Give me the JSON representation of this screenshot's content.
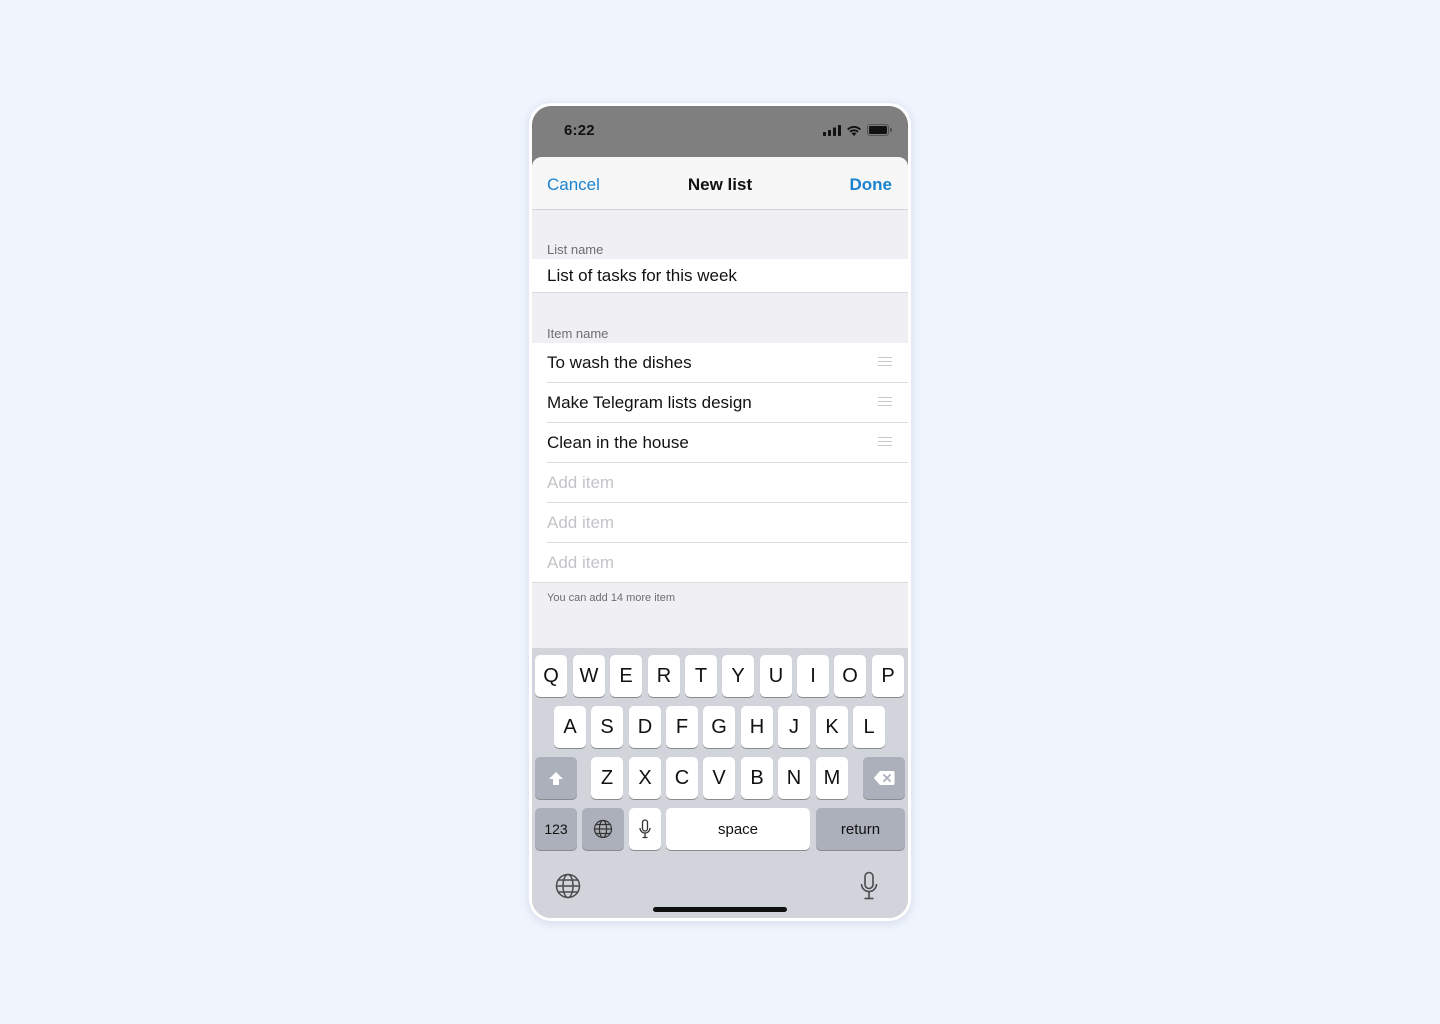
{
  "status_bar": {
    "time": "6:22",
    "icons": [
      "cellular-signal-icon",
      "wifi-icon",
      "battery-icon"
    ]
  },
  "navbar": {
    "cancel_label": "Cancel",
    "title": "New list",
    "done_label": "Done",
    "accent_color": "#1a83cf"
  },
  "list_name": {
    "label": "List name",
    "value": "List of tasks for this week"
  },
  "items": {
    "label": "Item name",
    "entries": [
      {
        "text": "To wash the dishes"
      },
      {
        "text": "Make Telegram lists design"
      },
      {
        "text": "Clean in the house"
      }
    ],
    "empty_placeholders": [
      "Add item",
      "Add item",
      "Add item"
    ],
    "hint": "You can add 14 more item"
  },
  "keyboard": {
    "row1": [
      "Q",
      "W",
      "E",
      "R",
      "T",
      "Y",
      "U",
      "I",
      "O",
      "P"
    ],
    "row2": [
      "A",
      "S",
      "D",
      "F",
      "G",
      "H",
      "J",
      "K",
      "L"
    ],
    "row3": [
      "Z",
      "X",
      "C",
      "V",
      "B",
      "N",
      "M"
    ],
    "numbers_label": "123",
    "space_label": "space",
    "return_label": "return"
  }
}
